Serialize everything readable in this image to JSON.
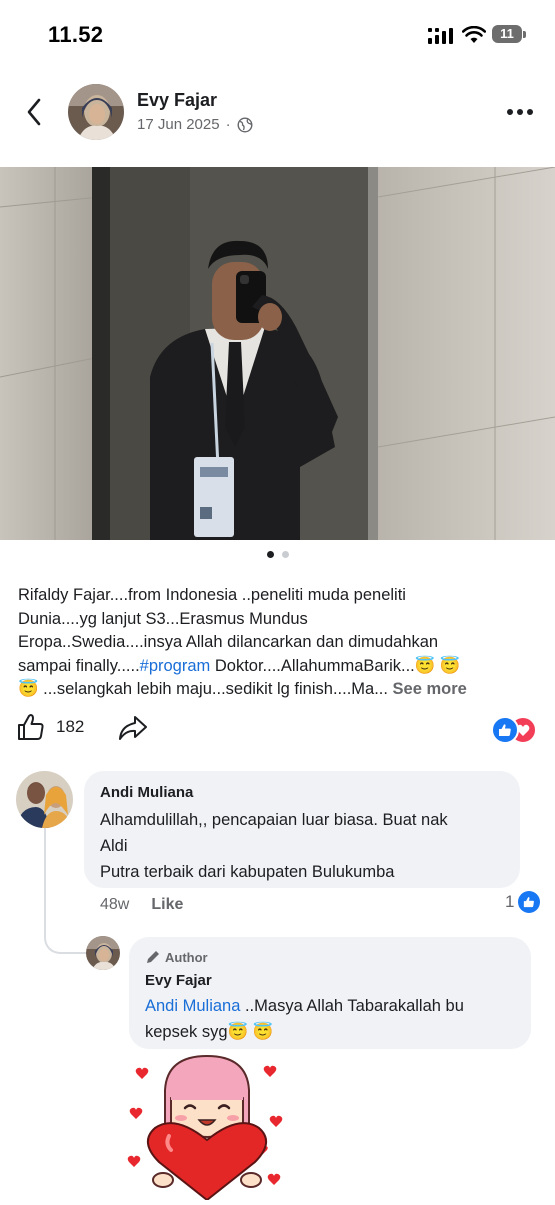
{
  "status_bar": {
    "time": "11.52",
    "battery": "11"
  },
  "post": {
    "author": "Evy Fajar",
    "date": "17 Jun 2025",
    "meta_separator": "·",
    "audience_icon": "globe-icon",
    "photo_page_count": 2,
    "photo_active_index": 0,
    "caption_lines": [
      "Rifaldy Fajar....from Indonesia ..peneliti muda peneliti",
      "Dunia....yg lanjut S3...Erasmus Mundus",
      "Eropa..Swedia....insya Allah dilancarkan  dan dimudahkan",
      "sampai finally.....",
      "#program",
      " Doktor....AllahummaBarik...😇 😇",
      "😇 ...selangkah lebih maju...sedikit lg finish....Ma... ",
      "See more"
    ],
    "like_count": "182",
    "reactions": [
      "like-reaction",
      "love-reaction"
    ]
  },
  "comments": [
    {
      "name": "Andi Muliana",
      "lines": [
        "Alhamdulillah,, pencapaian luar biasa. Buat nak",
        "Aldi",
        "Putra terbaik dari kabupaten Bulukumba"
      ],
      "time": "48w",
      "like_label": "Like",
      "like_count": "1"
    },
    {
      "badge": "Author",
      "name": "Evy Fajar",
      "mention": "Andi Muliana",
      "text_after_mention": " ..Masya Allah Tabarakallah bu",
      "line2": "kepsek syg😇 😇",
      "sticker": "girl-hugging-heart-sticker"
    }
  ],
  "colors": {
    "link": "#1a6ed8",
    "like_blue": "#1877f2",
    "love_red": "#f33e58",
    "bubble": "#f0f2f5",
    "secondary_text": "#65676b"
  }
}
